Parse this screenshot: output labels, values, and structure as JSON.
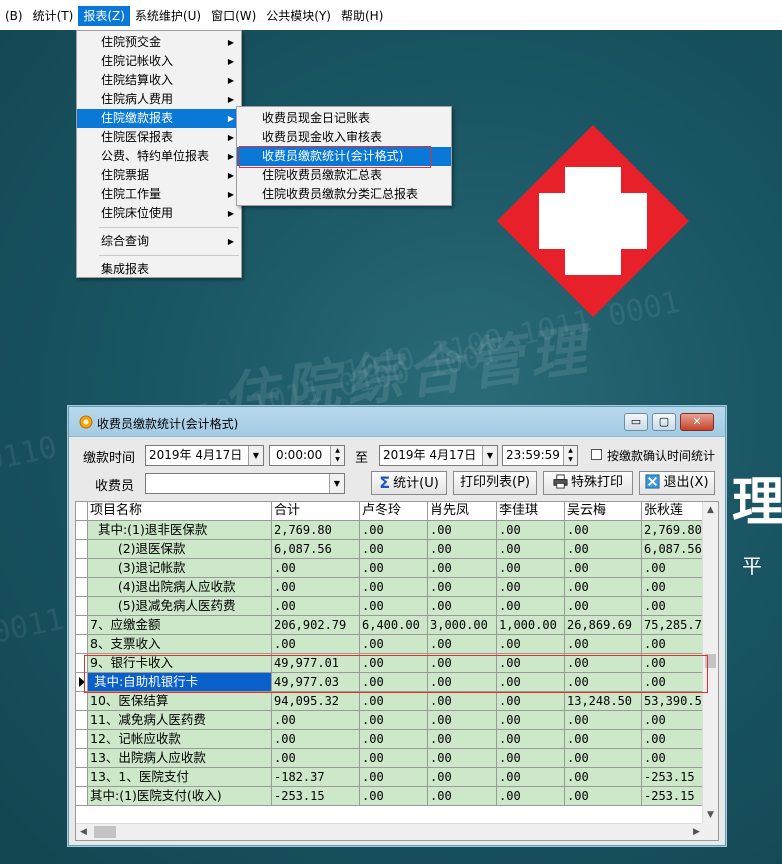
{
  "menubar": {
    "items": [
      "(B)",
      "统计(T)",
      "报表(Z)",
      "系统维护(U)",
      "窗口(W)",
      "公共模块(Y)",
      "帮助(H)"
    ],
    "active_index": 2
  },
  "report_menu": {
    "items": [
      {
        "label": "住院预交金",
        "submenu": true
      },
      {
        "label": "住院记帐收入",
        "submenu": true
      },
      {
        "label": "住院结算收入",
        "submenu": true
      },
      {
        "label": "住院病人费用",
        "submenu": true
      },
      {
        "label": "住院缴款报表",
        "submenu": true,
        "active": true
      },
      {
        "label": "住院医保报表",
        "submenu": true
      },
      {
        "label": "公费、特约单位报表",
        "submenu": true
      },
      {
        "label": "住院票据",
        "submenu": true
      },
      {
        "label": "住院工作量",
        "submenu": true
      },
      {
        "label": "住院床位使用",
        "submenu": true
      },
      {
        "label": "综合查询",
        "submenu": true
      },
      {
        "label": "集成报表",
        "submenu": false
      }
    ]
  },
  "payment_submenu": {
    "items": [
      "收费员现金日记账表",
      "收费员现金收入审核表",
      "收费员缴款统计(会计格式)",
      "住院收费员缴款汇总表",
      "住院收费员缴款分类汇总报表"
    ],
    "highlighted_index": 2
  },
  "window": {
    "title": "收费员缴款统计(会计格式)",
    "controls": {
      "min": "▭",
      "max": "▢",
      "close": "✕"
    }
  },
  "filters": {
    "time_label": "缴款时间",
    "start_date": "2019年  4月17日",
    "start_time": "0:00:00",
    "to_label": "至",
    "end_date": "2019年  4月17日",
    "end_time": "23:59:59",
    "confirm_checkbox_label": "按缴款确认时间统计",
    "confirm_checked": false,
    "collector_label": "收费员",
    "collector_value": ""
  },
  "buttons": {
    "stats": "统计(U)",
    "print_list": "打印列表(P)",
    "special_print": "特殊打印",
    "exit": "退出(X)"
  },
  "table": {
    "columns": [
      "项目名称",
      "合计",
      "卢冬玲",
      "肖先凤",
      "李佳琪",
      "吴云梅",
      "张秋莲"
    ],
    "rows": [
      [
        "  其中:(1)退非医保款",
        "2,769.80",
        ".00",
        ".00",
        ".00",
        ".00",
        "2,769.80"
      ],
      [
        "       (2)退医保款",
        "6,087.56",
        ".00",
        ".00",
        ".00",
        ".00",
        "6,087.56"
      ],
      [
        "       (3)退记帐款",
        ".00",
        ".00",
        ".00",
        ".00",
        ".00",
        ".00"
      ],
      [
        "       (4)退出院病人应收款",
        ".00",
        ".00",
        ".00",
        ".00",
        ".00",
        ".00"
      ],
      [
        "       (5)退减免病人医药费",
        ".00",
        ".00",
        ".00",
        ".00",
        ".00",
        ".00"
      ],
      [
        "7、应缴金额",
        "206,902.79",
        "6,400.00",
        "3,000.00",
        "1,000.00",
        "26,869.69",
        "75,285.7"
      ],
      [
        "8、支票收入",
        ".00",
        ".00",
        ".00",
        ".00",
        ".00",
        ".00"
      ],
      [
        "9、银行卡收入",
        "49,977.01",
        ".00",
        ".00",
        ".00",
        ".00",
        ".00"
      ],
      [
        " 其中:自助机银行卡",
        "49,977.03",
        ".00",
        ".00",
        ".00",
        ".00",
        ".00"
      ],
      [
        "10、医保结算",
        "94,095.32",
        ".00",
        ".00",
        ".00",
        "13,248.50",
        "53,390.5"
      ],
      [
        "11、减免病人医药费",
        ".00",
        ".00",
        ".00",
        ".00",
        ".00",
        ".00"
      ],
      [
        "12、记帐应收款",
        ".00",
        ".00",
        ".00",
        ".00",
        ".00",
        ".00"
      ],
      [
        "13、出院病人应收款",
        ".00",
        ".00",
        ".00",
        ".00",
        ".00",
        ".00"
      ],
      [
        "13、1、医院支付",
        "-182.37",
        ".00",
        ".00",
        ".00",
        ".00",
        "-253.15"
      ],
      [
        "其中:(1)医院支付(收入)",
        "-253.15",
        ".00",
        ".00",
        ".00",
        ".00",
        "-253.15"
      ]
    ],
    "current_row": 8
  },
  "desktop": {
    "big_char": "理",
    "small_char": "平",
    "banner_text": "住院综合管理"
  },
  "colors": {
    "accent": "#0a78d7",
    "grid_fill": "#cce8c9",
    "highlight_box": "#e23030",
    "logo_red": "#e8202a"
  }
}
